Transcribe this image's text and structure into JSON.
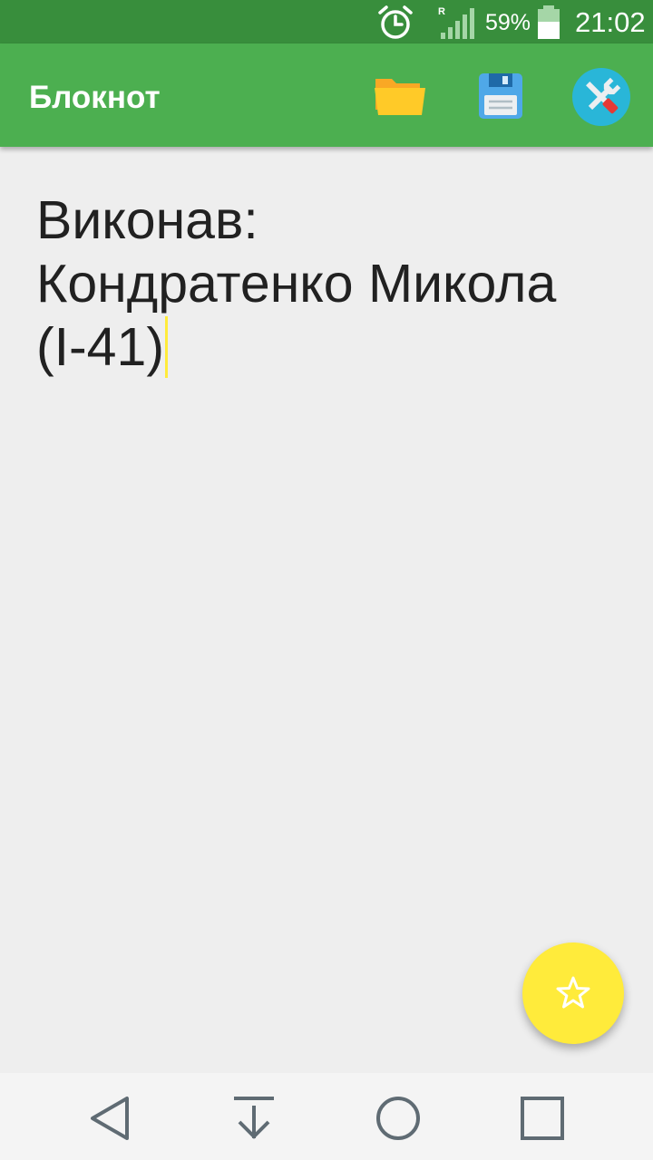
{
  "status_bar": {
    "roaming_indicator": "R",
    "battery_percent": "59%",
    "time": "21:02",
    "icons": [
      "alarm-icon",
      "signal-icon",
      "battery-icon"
    ]
  },
  "app_bar": {
    "title": "Блокнот",
    "actions": [
      "open-folder-icon",
      "save-floppy-icon",
      "settings-tools-icon"
    ]
  },
  "editor": {
    "lines": [
      "Виконав:",
      "Кондратенко Микола",
      "(І-41)"
    ]
  },
  "fab": {
    "icon": "star-outline-icon"
  },
  "nav_bar": {
    "buttons": [
      "back-icon",
      "download-icon",
      "home-icon",
      "recents-icon"
    ]
  },
  "colors": {
    "status_bar": "#388e3c",
    "app_bar": "#4caf50",
    "accent": "#ffeb3b",
    "background": "#eeeeee"
  }
}
